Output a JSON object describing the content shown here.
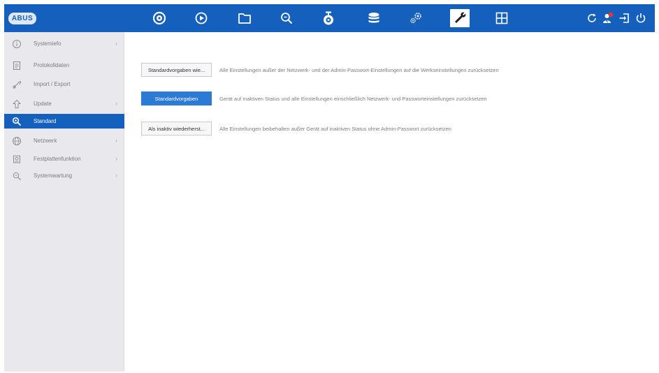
{
  "brand": {
    "logo_text": "ABUS"
  },
  "colors": {
    "accent": "#1560bd",
    "sidebar_bg": "#e9e9ed",
    "primary_button": "#2a7ad6"
  },
  "topnav": {
    "items": [
      {
        "name": "live-view-camera-icon",
        "active": false
      },
      {
        "name": "playback-icon",
        "active": false
      },
      {
        "name": "files-folder-icon",
        "active": false
      },
      {
        "name": "smart-search-icon",
        "active": false
      },
      {
        "name": "camera-setup-icon",
        "active": false
      },
      {
        "name": "storage-database-icon",
        "active": false
      },
      {
        "name": "system-settings-gears-icon",
        "active": false
      },
      {
        "name": "maintenance-wrench-icon",
        "active": true
      },
      {
        "name": "multi-view-grid-icon",
        "active": false
      }
    ],
    "right": [
      {
        "name": "refresh-icon"
      },
      {
        "name": "user-alert-icon"
      },
      {
        "name": "logout-icon"
      },
      {
        "name": "power-icon"
      }
    ]
  },
  "sidebar": {
    "items": [
      {
        "label": "Systemiefo",
        "icon": "info-circle-icon",
        "chevron": true,
        "active": false
      },
      {
        "label": "Protokolldaten",
        "icon": "log-document-icon",
        "chevron": false,
        "active": false
      },
      {
        "label": "Import / Export",
        "icon": "import-export-icon",
        "chevron": false,
        "active": false
      },
      {
        "label": "Update",
        "icon": "update-arrow-icon",
        "chevron": true,
        "active": false
      },
      {
        "label": "Standard",
        "icon": "default-reset-icon",
        "chevron": false,
        "active": true
      },
      {
        "label": "Netzwerk",
        "icon": "network-globe-icon",
        "chevron": true,
        "active": false
      },
      {
        "label": "Festplattenfunktion",
        "icon": "hdd-icon",
        "chevron": true,
        "active": false
      },
      {
        "label": "Systemwartung",
        "icon": "system-service-icon",
        "chevron": true,
        "active": false
      }
    ],
    "chevron_glyph": "›"
  },
  "main": {
    "actions": [
      {
        "button": "Standardvorgaben wie...",
        "description": "Alle Einstellungen außer der Netzwerk- und der Admin-Passwort-Einstellungen auf die Werkseinstellungen zurücksetzen",
        "primary": false
      },
      {
        "button": "Standardvorgaben",
        "description": "Gerät auf inaktiven Status und alle Einstellungen einschließlich Netzwerk- und Passworteinstellungen zurücksetzen",
        "primary": true
      },
      {
        "button": "Als inaktiv wiederherst...",
        "description": "Alle Einstellungen beibehalten außer Gerät auf inaktiven Status ohne Admin-Passwort zurücksetzen",
        "primary": false
      }
    ]
  }
}
